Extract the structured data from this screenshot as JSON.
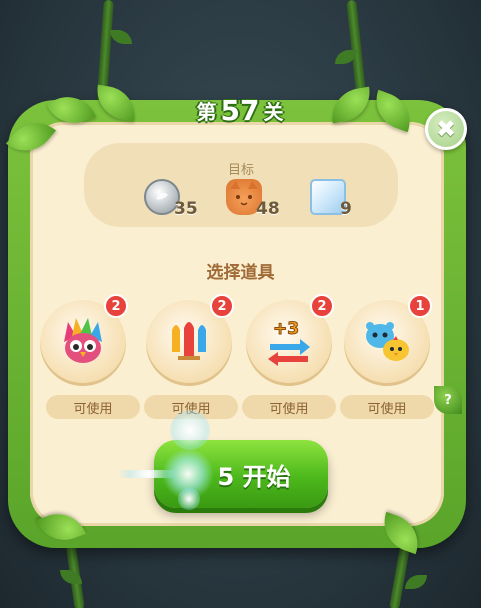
{
  "level": {
    "prefix": "第",
    "number": "57",
    "suffix": "关"
  },
  "close": {
    "icon": "close-icon",
    "glyph": "✖"
  },
  "goals": {
    "title": "目标",
    "items": [
      {
        "icon": "silver-coin-icon",
        "count": "35"
      },
      {
        "icon": "cookie-cat-icon",
        "count": "48"
      },
      {
        "icon": "ice-block-icon",
        "count": "9"
      }
    ]
  },
  "boosters": {
    "title": "选择道具",
    "items": [
      {
        "icon": "rainbow-owl-icon",
        "badge": "2",
        "label": "可使用"
      },
      {
        "icon": "rockets-icon",
        "badge": "2",
        "label": "可使用"
      },
      {
        "icon": "plus-three-moves-icon",
        "badge": "2",
        "label": "可使用",
        "art_text": "+3"
      },
      {
        "icon": "pets-icon",
        "badge": "1",
        "label": "可使用"
      }
    ]
  },
  "help": {
    "glyph": "?"
  },
  "start": {
    "label": "5 开始"
  },
  "colors": {
    "frame_green": "#5aa52a",
    "panel_cream": "#fbefd2",
    "badge_red": "#e8423c",
    "button_green": "#4cb81c"
  }
}
